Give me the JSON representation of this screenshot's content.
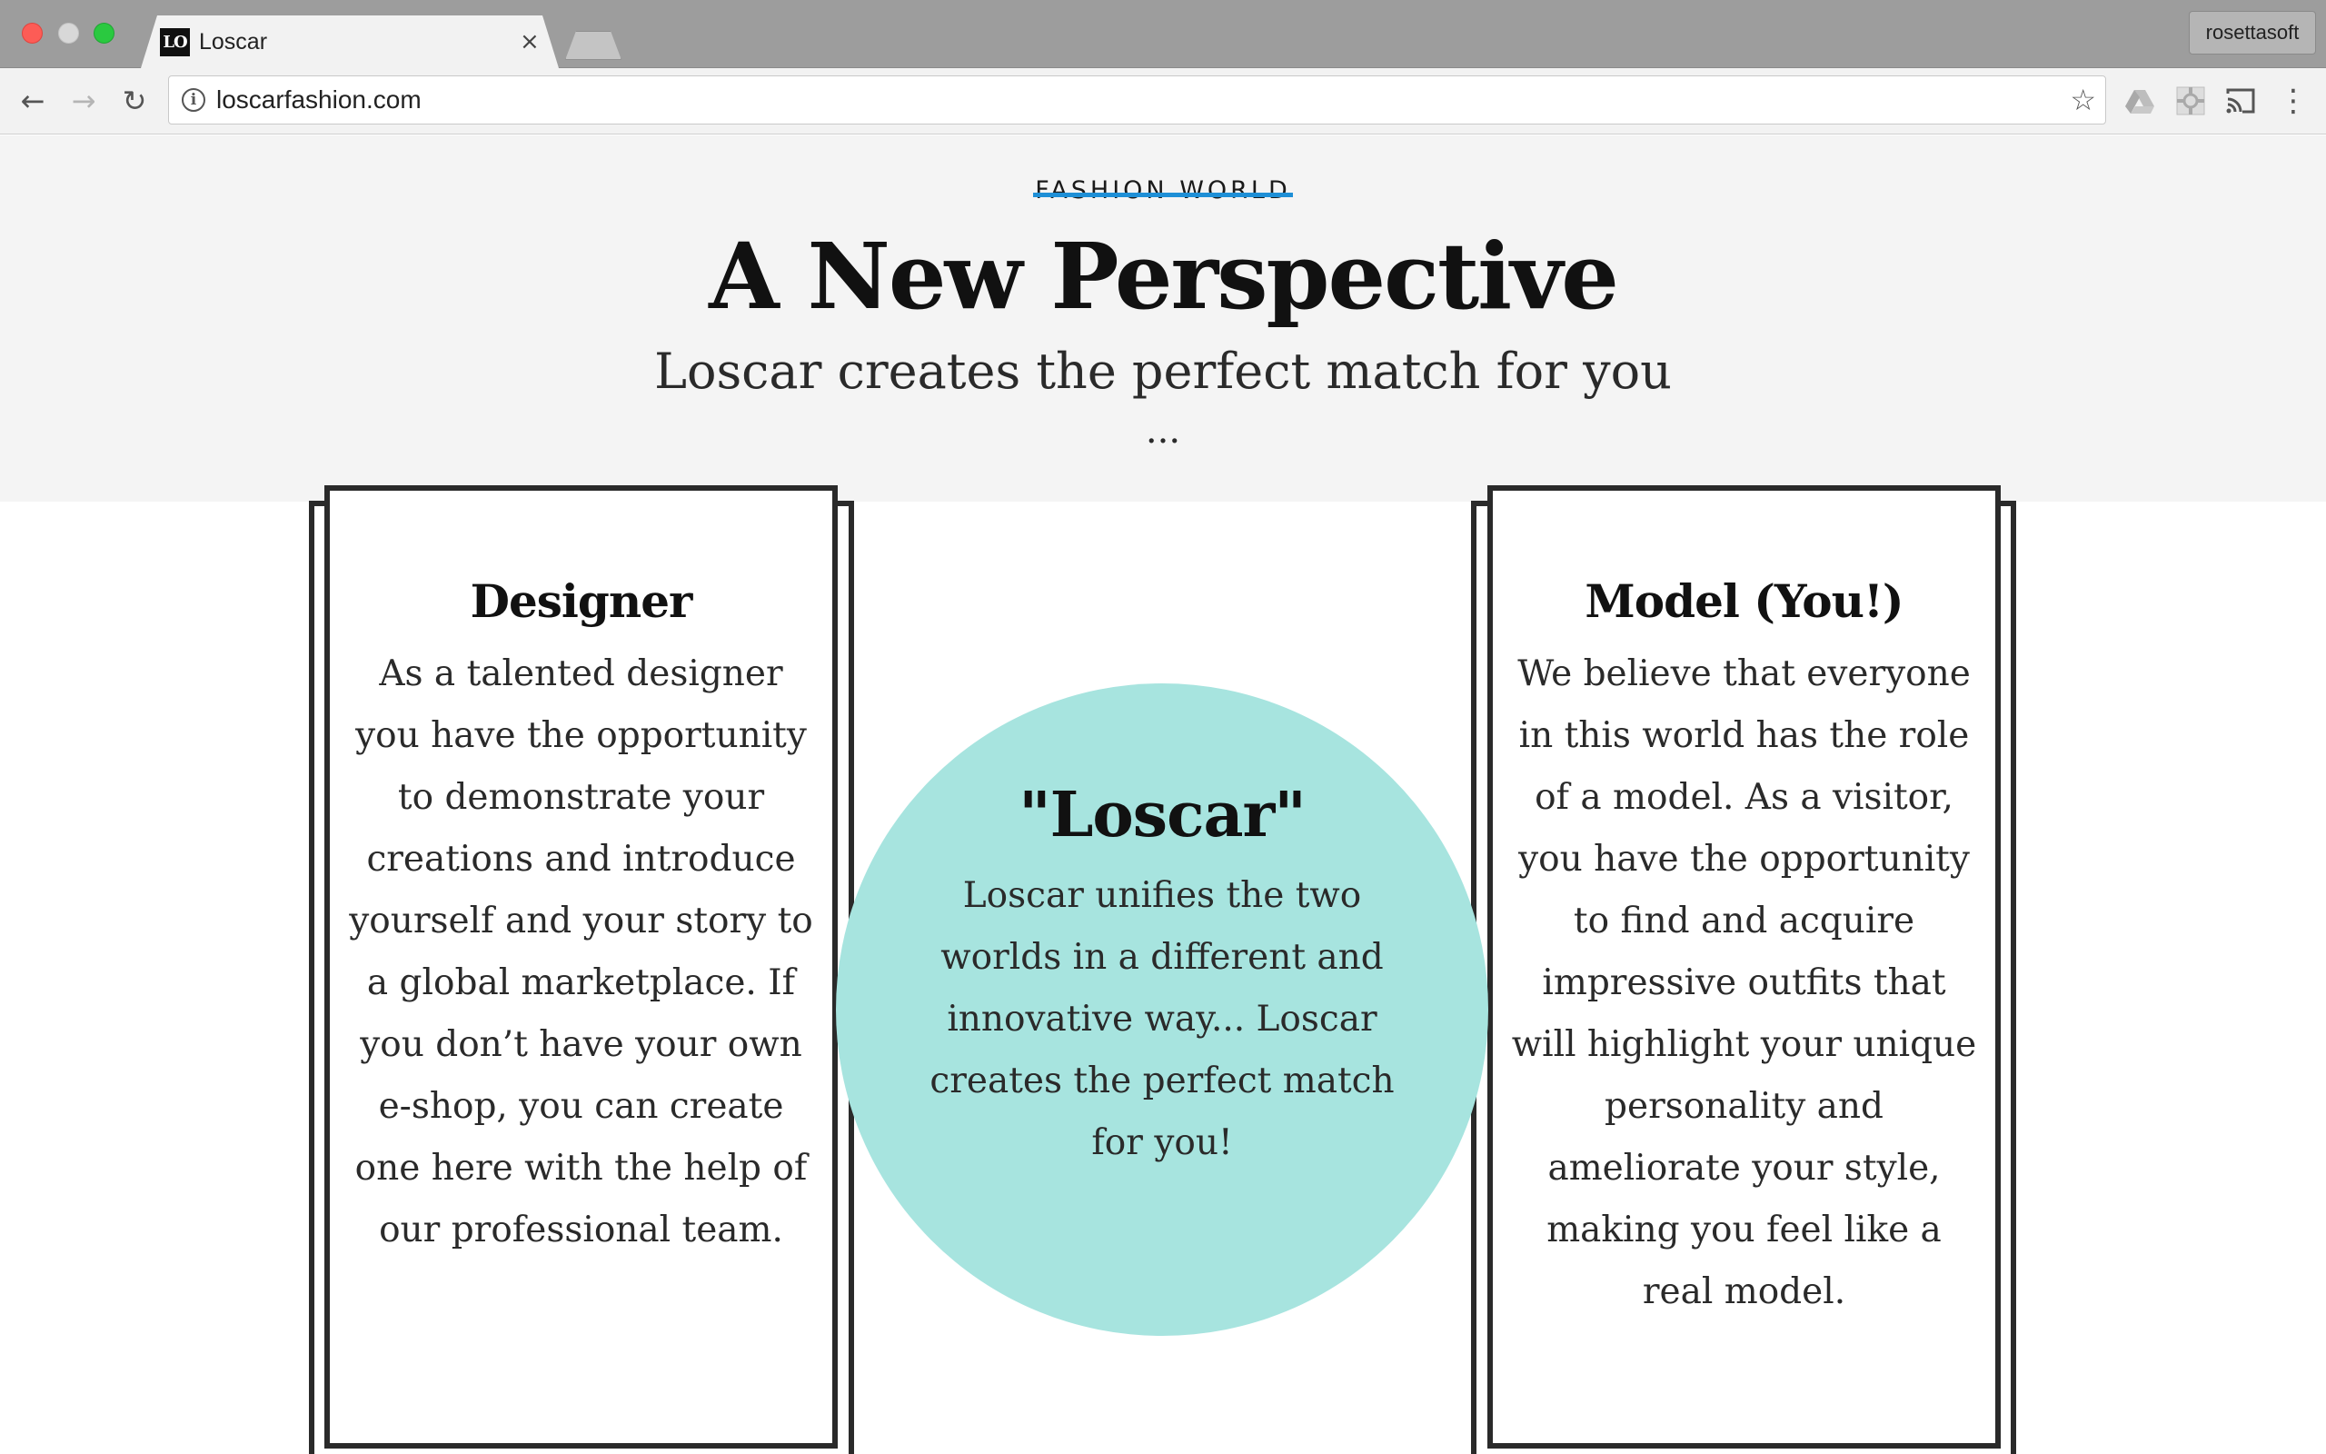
{
  "browser": {
    "tab_title": "Loscar",
    "favicon_text": "LO",
    "tab_close": "×",
    "profile_name": "rosettasoft",
    "url": "loscarfashion.com",
    "icons": {
      "back": "←",
      "forward": "→",
      "reload": "↻",
      "info": "i",
      "bookmark": "☆",
      "menu": "⋮"
    }
  },
  "hero": {
    "eyebrow": "FASHION WORLD",
    "headline": "A New Perspective",
    "subline": "Loscar creates the perfect match for you",
    "ellipsis": "..."
  },
  "cards": {
    "designer": {
      "title": "Designer",
      "body": "As a talented designer you have the opportunity to demonstrate your creations and introduce yourself and your story to a global marketplace. If you don’t have your own e-shop, you can create one here with the help of our professional team."
    },
    "model": {
      "title": "Model (You!)",
      "body": "We believe that everyone in this world has the role of a model. As a visitor, you have the opportunity to find and acquire impressive outfits that will highlight your unique personality and ameliorate your style, making you feel like a real model."
    }
  },
  "center": {
    "title": "\"Loscar\"",
    "body": "Loscar unifies the two worlds in a different and innovative way... Loscar creates the perfect match for you!"
  },
  "colors": {
    "accent_circle": "#a7e4df",
    "eyebrow_strike": "#1e8fd6",
    "hero_bg": "#f4f4f4",
    "frame": "#2a2a2a"
  }
}
